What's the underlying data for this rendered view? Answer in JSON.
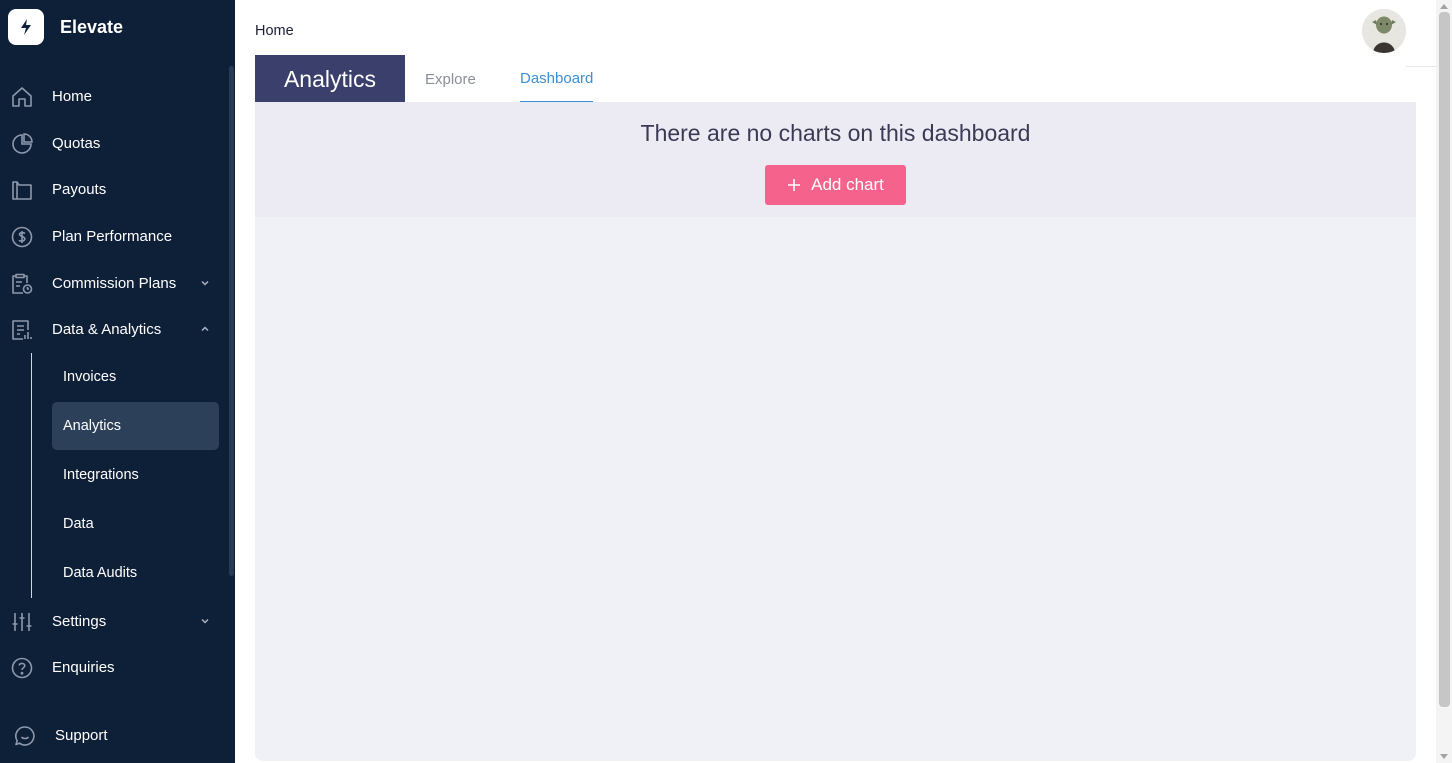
{
  "app": {
    "name": "Elevate"
  },
  "sidebar": {
    "items": [
      {
        "label": "Home",
        "icon": "home-icon"
      },
      {
        "label": "Quotas",
        "icon": "pie-chart-icon"
      },
      {
        "label": "Payouts",
        "icon": "wallet-icon"
      },
      {
        "label": "Plan Performance",
        "icon": "dollar-circle-icon"
      },
      {
        "label": "Commission Plans",
        "icon": "clipboard-clock-icon",
        "expanded": false
      },
      {
        "label": "Data & Analytics",
        "icon": "document-report-icon",
        "expanded": true
      },
      {
        "label": "Settings",
        "icon": "sliders-icon",
        "expanded": false
      },
      {
        "label": "Enquiries",
        "icon": "help-circle-icon"
      }
    ],
    "sub_items": [
      {
        "label": "Invoices"
      },
      {
        "label": "Analytics",
        "active": true
      },
      {
        "label": "Integrations"
      },
      {
        "label": "Data"
      },
      {
        "label": "Data Audits"
      }
    ],
    "support": {
      "label": "Support",
      "icon": "chat-bubble-icon"
    }
  },
  "header": {
    "breadcrumb": "Home"
  },
  "tabs": {
    "title": "Analytics",
    "items": [
      {
        "label": "Explore",
        "active": false
      },
      {
        "label": "Dashboard",
        "active": true
      }
    ]
  },
  "main": {
    "empty_message": "There are no charts on this dashboard",
    "add_chart_label": "Add chart"
  },
  "colors": {
    "sidebar_bg": "#0e1f38",
    "active_sub_bg": "#2c4059",
    "tab_title_bg": "#3b3f6b",
    "active_tab": "#3b8fd4",
    "add_button": "#f5628c",
    "panel_bg": "#f0f1f6"
  }
}
